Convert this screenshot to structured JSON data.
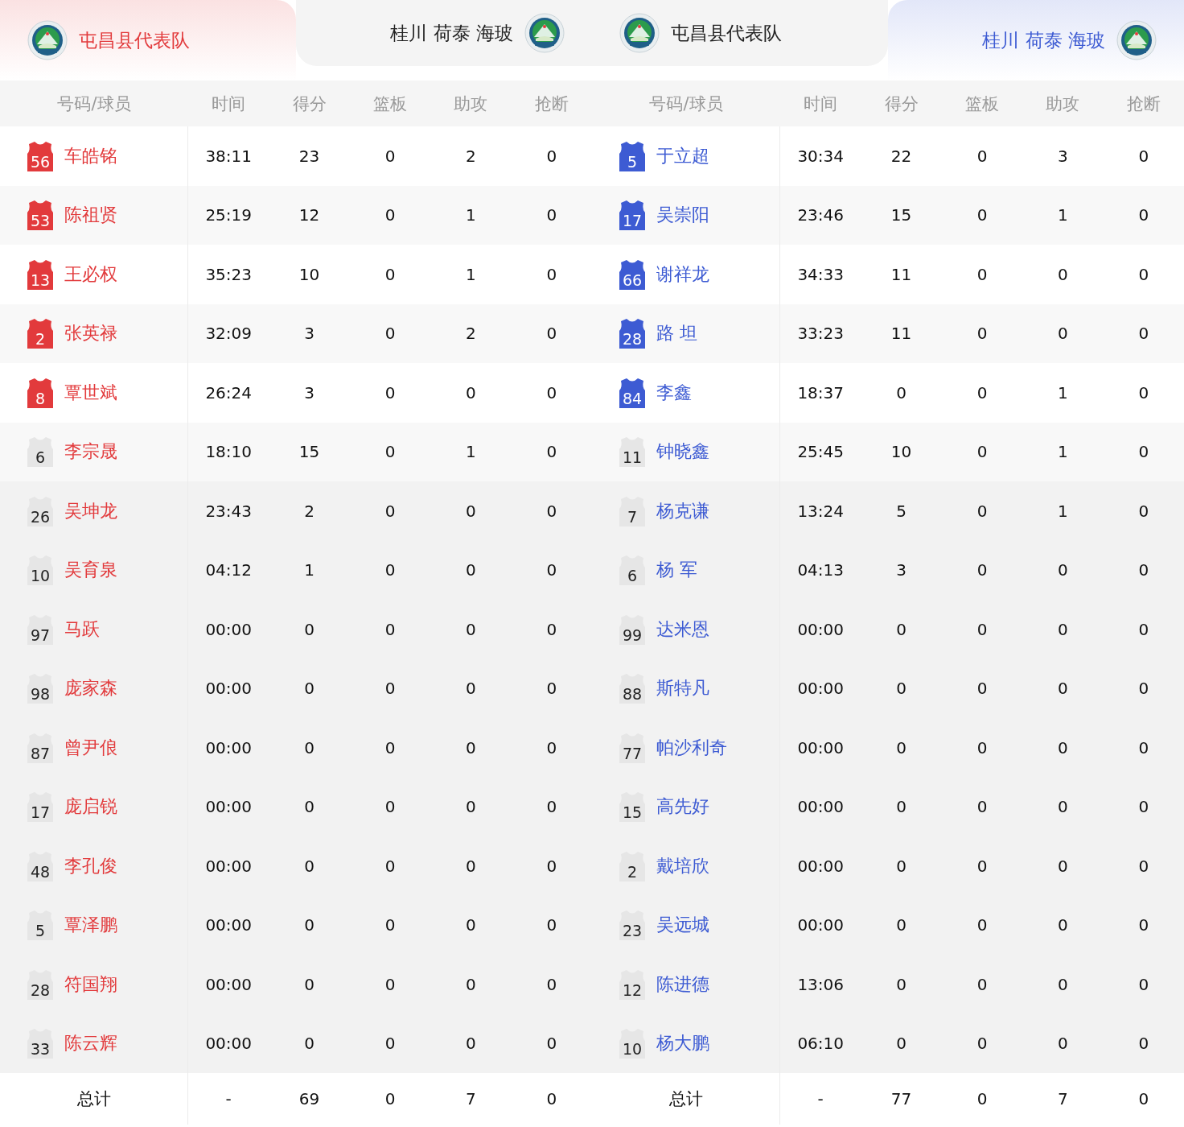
{
  "panels": [
    {
      "color": "#e23a3c",
      "tabs": [
        {
          "name": "屯昌县代表队",
          "selected": true
        },
        {
          "name": "桂川 荷泰 海玻",
          "selected": false
        }
      ],
      "columns": [
        "号码/球员",
        "时间",
        "得分",
        "篮板",
        "助攻",
        "抢断"
      ],
      "players": [
        {
          "number": "56",
          "name": "车皓铭",
          "starter": true,
          "stats": [
            "38:11",
            "23",
            "0",
            "2",
            "0"
          ]
        },
        {
          "number": "53",
          "name": "陈祖贤",
          "starter": true,
          "stats": [
            "25:19",
            "12",
            "0",
            "1",
            "0"
          ]
        },
        {
          "number": "13",
          "name": "王必权",
          "starter": true,
          "stats": [
            "35:23",
            "10",
            "0",
            "1",
            "0"
          ]
        },
        {
          "number": "2",
          "name": "张英禄",
          "starter": true,
          "stats": [
            "32:09",
            "3",
            "0",
            "2",
            "0"
          ]
        },
        {
          "number": "8",
          "name": "覃世斌",
          "starter": true,
          "stats": [
            "26:24",
            "3",
            "0",
            "0",
            "0"
          ]
        },
        {
          "number": "6",
          "name": "李宗晟",
          "starter": false,
          "stats": [
            "18:10",
            "15",
            "0",
            "1",
            "0"
          ]
        },
        {
          "number": "26",
          "name": "吴坤龙",
          "starter": false,
          "stats": [
            "23:43",
            "2",
            "0",
            "0",
            "0"
          ]
        },
        {
          "number": "10",
          "name": "吴育泉",
          "starter": false,
          "stats": [
            "04:12",
            "1",
            "0",
            "0",
            "0"
          ]
        },
        {
          "number": "97",
          "name": "马跃",
          "starter": false,
          "stats": [
            "00:00",
            "0",
            "0",
            "0",
            "0"
          ]
        },
        {
          "number": "98",
          "name": "庞家森",
          "starter": false,
          "stats": [
            "00:00",
            "0",
            "0",
            "0",
            "0"
          ]
        },
        {
          "number": "87",
          "name": "曾尹俍",
          "starter": false,
          "stats": [
            "00:00",
            "0",
            "0",
            "0",
            "0"
          ]
        },
        {
          "number": "17",
          "name": "庞启锐",
          "starter": false,
          "stats": [
            "00:00",
            "0",
            "0",
            "0",
            "0"
          ]
        },
        {
          "number": "48",
          "name": "李孔俊",
          "starter": false,
          "stats": [
            "00:00",
            "0",
            "0",
            "0",
            "0"
          ]
        },
        {
          "number": "5",
          "name": "覃泽鹏",
          "starter": false,
          "stats": [
            "00:00",
            "0",
            "0",
            "0",
            "0"
          ]
        },
        {
          "number": "28",
          "name": "符国翔",
          "starter": false,
          "stats": [
            "00:00",
            "0",
            "0",
            "0",
            "0"
          ]
        },
        {
          "number": "33",
          "name": "陈云辉",
          "starter": false,
          "stats": [
            "00:00",
            "0",
            "0",
            "0",
            "0"
          ]
        }
      ],
      "total": {
        "label": "总计",
        "stats": [
          "-",
          "69",
          "0",
          "7",
          "0"
        ]
      }
    },
    {
      "color": "#3d5bd3",
      "tabs": [
        {
          "name": "屯昌县代表队",
          "selected": false
        },
        {
          "name": "桂川 荷泰 海玻",
          "selected": true
        }
      ],
      "columns": [
        "号码/球员",
        "时间",
        "得分",
        "篮板",
        "助攻",
        "抢断"
      ],
      "players": [
        {
          "number": "5",
          "name": "于立超",
          "starter": true,
          "stats": [
            "30:34",
            "22",
            "0",
            "3",
            "0"
          ]
        },
        {
          "number": "17",
          "name": "吴崇阳",
          "starter": true,
          "stats": [
            "23:46",
            "15",
            "0",
            "1",
            "0"
          ]
        },
        {
          "number": "66",
          "name": "谢祥龙",
          "starter": true,
          "stats": [
            "34:33",
            "11",
            "0",
            "0",
            "0"
          ]
        },
        {
          "number": "28",
          "name": "路 坦",
          "starter": true,
          "stats": [
            "33:23",
            "11",
            "0",
            "0",
            "0"
          ]
        },
        {
          "number": "84",
          "name": "李鑫",
          "starter": true,
          "stats": [
            "18:37",
            "0",
            "0",
            "1",
            "0"
          ]
        },
        {
          "number": "11",
          "name": "钟晓鑫",
          "starter": false,
          "stats": [
            "25:45",
            "10",
            "0",
            "1",
            "0"
          ]
        },
        {
          "number": "7",
          "name": "杨克谦",
          "starter": false,
          "stats": [
            "13:24",
            "5",
            "0",
            "1",
            "0"
          ]
        },
        {
          "number": "6",
          "name": "杨 军",
          "starter": false,
          "stats": [
            "04:13",
            "3",
            "0",
            "0",
            "0"
          ]
        },
        {
          "number": "99",
          "name": "达米恩",
          "starter": false,
          "stats": [
            "00:00",
            "0",
            "0",
            "0",
            "0"
          ]
        },
        {
          "number": "88",
          "name": "斯特凡",
          "starter": false,
          "stats": [
            "00:00",
            "0",
            "0",
            "0",
            "0"
          ]
        },
        {
          "number": "77",
          "name": "帕沙利奇",
          "starter": false,
          "stats": [
            "00:00",
            "0",
            "0",
            "0",
            "0"
          ]
        },
        {
          "number": "15",
          "name": "高先好",
          "starter": false,
          "stats": [
            "00:00",
            "0",
            "0",
            "0",
            "0"
          ]
        },
        {
          "number": "2",
          "name": "戴培欣",
          "starter": false,
          "stats": [
            "00:00",
            "0",
            "0",
            "0",
            "0"
          ]
        },
        {
          "number": "23",
          "name": "吴远城",
          "starter": false,
          "stats": [
            "00:00",
            "0",
            "0",
            "0",
            "0"
          ]
        },
        {
          "number": "12",
          "name": "陈进德",
          "starter": false,
          "stats": [
            "13:06",
            "0",
            "0",
            "0",
            "0"
          ]
        },
        {
          "number": "10",
          "name": "杨大鹏",
          "starter": false,
          "stats": [
            "06:10",
            "0",
            "0",
            "0",
            "0"
          ]
        }
      ],
      "total": {
        "label": "总计",
        "stats": [
          "-",
          "77",
          "0",
          "7",
          "0"
        ]
      }
    }
  ]
}
